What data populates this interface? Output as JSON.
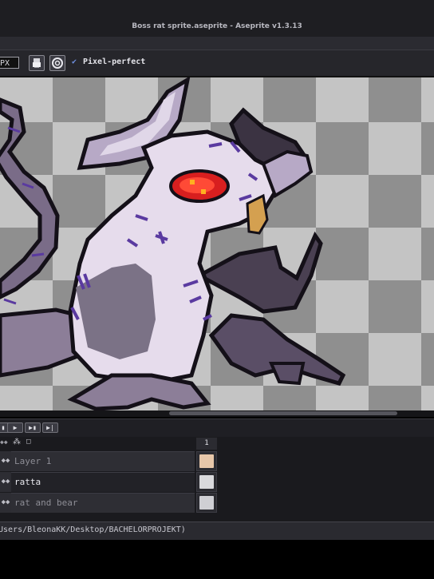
{
  "window": {
    "title": "Boss rat sprite.aseprite - Aseprite v1.3.13"
  },
  "context_bar": {
    "brush_size": "PX",
    "pixel_perfect_checked": true,
    "pixel_perfect_label": "Pixel-perfect"
  },
  "timeline": {
    "frame_header": "1",
    "layers": [
      {
        "name": "Layer 1",
        "active": false
      },
      {
        "name": "ratta",
        "active": true
      },
      {
        "name": "rat and bear",
        "active": false
      }
    ]
  },
  "status": {
    "path": "Users/BleonaKK/Desktop/BACHELORPROJEKT)"
  },
  "colors": {
    "rat_body": "#e6dcec",
    "rat_shadow": "#b7a9c6",
    "rat_dark": "#4a4052",
    "outline": "#141018",
    "scar": "#5a3aa0",
    "eye": "#d81f1f",
    "tail": "#7a6c88",
    "checker_light": "#c4c4c4",
    "checker_dark": "#8f8f8f"
  }
}
